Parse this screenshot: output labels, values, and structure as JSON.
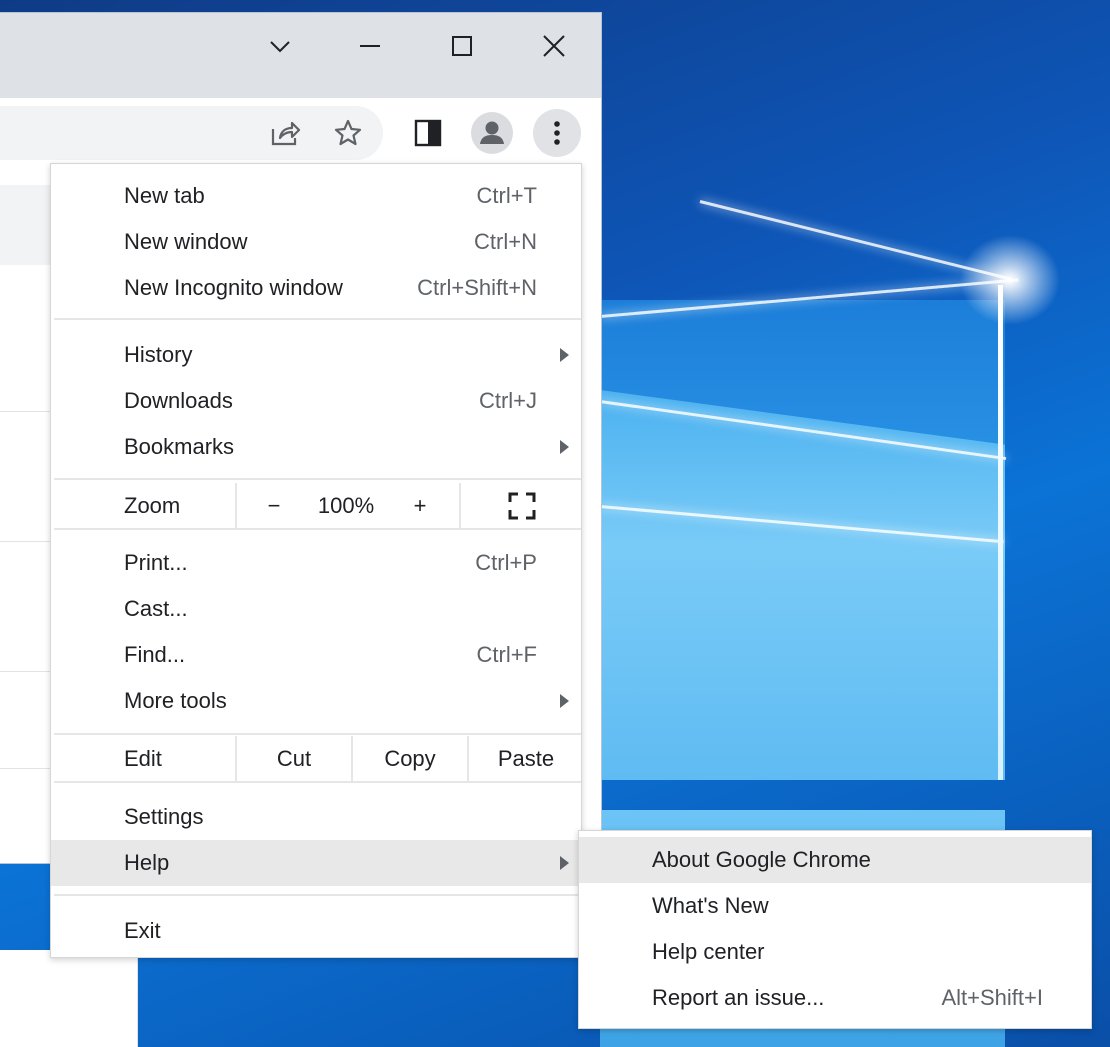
{
  "window": {
    "icons": [
      "chevron-down-icon",
      "minimize-icon",
      "maximize-icon",
      "close-icon"
    ]
  },
  "toolbar": {
    "icons": [
      "share-icon",
      "star-icon",
      "side-panel-icon",
      "profile-icon",
      "more-vert-icon"
    ]
  },
  "menu": {
    "new_tab": {
      "label": "New tab",
      "shortcut": "Ctrl+T"
    },
    "new_window": {
      "label": "New window",
      "shortcut": "Ctrl+N"
    },
    "new_incognito": {
      "label": "New Incognito window",
      "shortcut": "Ctrl+Shift+N"
    },
    "history": {
      "label": "History"
    },
    "downloads": {
      "label": "Downloads",
      "shortcut": "Ctrl+J"
    },
    "bookmarks": {
      "label": "Bookmarks"
    },
    "zoom": {
      "label": "Zoom",
      "minus": "−",
      "value": "100%",
      "plus": "+"
    },
    "print": {
      "label": "Print...",
      "shortcut": "Ctrl+P"
    },
    "cast": {
      "label": "Cast..."
    },
    "find": {
      "label": "Find...",
      "shortcut": "Ctrl+F"
    },
    "more_tools": {
      "label": "More tools"
    },
    "edit": {
      "label": "Edit",
      "cut": "Cut",
      "copy": "Copy",
      "paste": "Paste"
    },
    "settings": {
      "label": "Settings"
    },
    "help": {
      "label": "Help"
    },
    "exit": {
      "label": "Exit"
    }
  },
  "help_menu": {
    "about": {
      "label": "About Google Chrome"
    },
    "whats_new": {
      "label": "What's New"
    },
    "help_center": {
      "label": "Help center"
    },
    "report": {
      "label": "Report an issue...",
      "shortcut": "Alt+Shift+I"
    }
  },
  "colors": {
    "menu_highlight": "#e8e8e8",
    "titlebar": "#dee1e6",
    "icon": "#5f6368"
  }
}
